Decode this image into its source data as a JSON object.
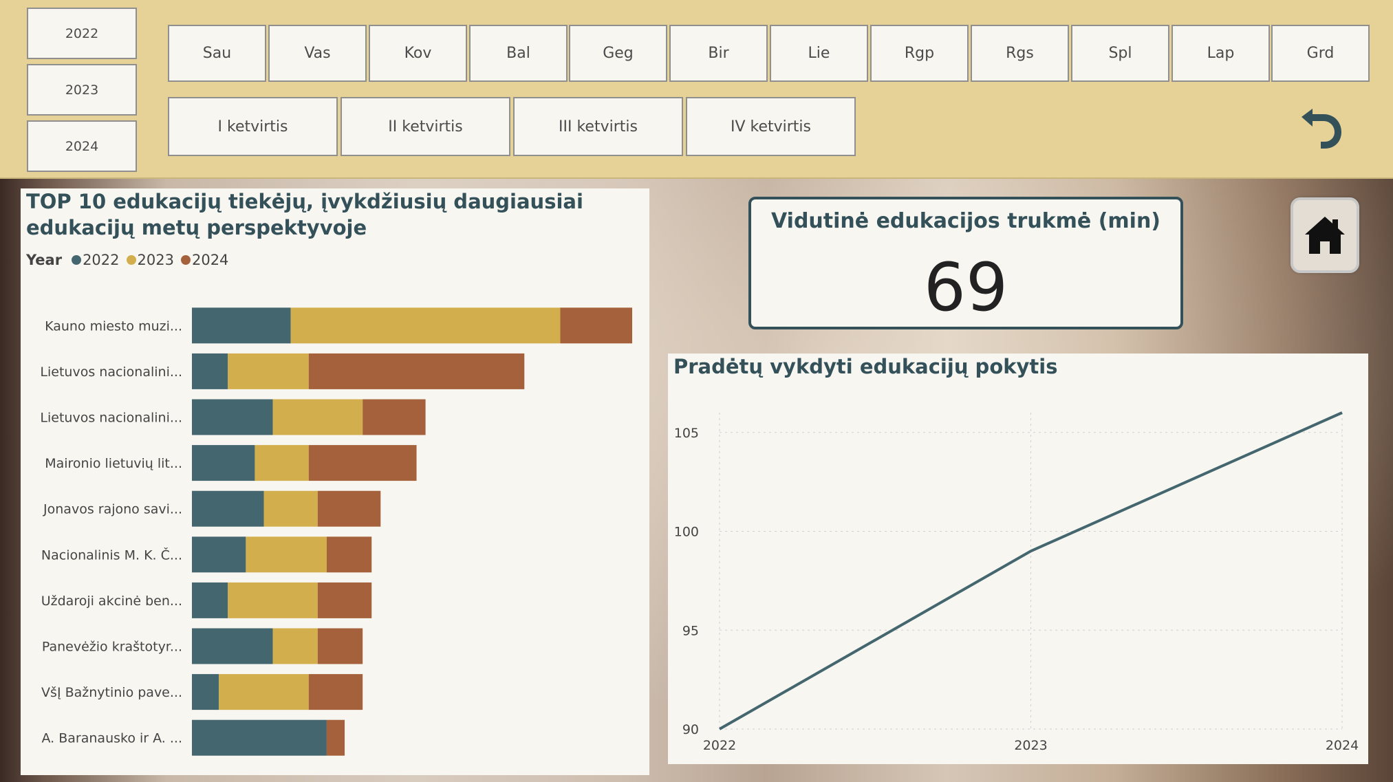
{
  "filters": {
    "years": [
      "2022",
      "2023",
      "2024"
    ],
    "months": [
      "Sau",
      "Vas",
      "Kov",
      "Bal",
      "Geg",
      "Bir",
      "Lie",
      "Rgp",
      "Rgs",
      "Spl",
      "Lap",
      "Grd"
    ],
    "quarters": [
      "I ketvirtis",
      "II ketvirtis",
      "III ketvirtis",
      "IV ketvirtis"
    ]
  },
  "icons": {
    "undo": "undo-arrow-icon",
    "home": "home-icon"
  },
  "colors": {
    "y2022": "#44666f",
    "y2023": "#d2ae4c",
    "y2024": "#a5613b",
    "line": "#44666f",
    "title": "#34515a"
  },
  "kpi": {
    "title": "Vidutinė edukacijos trukmė (min)",
    "value": "69"
  },
  "bar_panel": {
    "title_line1": "TOP 10 edukacijų tiekėjų, įvykdžiusių daugiausiai",
    "title_line2": "edukacijų metų perspektyvoje",
    "legend_title": "Year"
  },
  "line_panel": {
    "title": "Pradėtų vykdyti edukacijų pokytis"
  },
  "chart_data": [
    {
      "type": "bar",
      "orientation": "horizontal",
      "stacked": true,
      "title": "TOP 10 edukacijų tiekėjų, įvykdžiusių daugiausiai edukacijų metų perspektyvoje",
      "legend_title": "Year",
      "legend_position": "top-left",
      "categories": [
        "Kauno miesto muzi...",
        "Lietuvos nacionalini...",
        "Lietuvos nacionalini...",
        "Maironio lietuvių lit...",
        "Jonavos rajono savi...",
        "Nacionalinis M. K. Č...",
        "Uždaroji akcinė ben...",
        "Panevėžio kraštotyr...",
        "VšĮ Bažnytinio pave...",
        "A. Baranausko ir A. ..."
      ],
      "series": [
        {
          "name": "2022",
          "values": [
            11,
            4,
            9,
            7,
            8,
            6,
            4,
            9,
            3,
            15
          ]
        },
        {
          "name": "2023",
          "values": [
            30,
            9,
            10,
            6,
            6,
            9,
            10,
            5,
            10,
            0
          ]
        },
        {
          "name": "2024",
          "values": [
            8,
            24,
            7,
            12,
            7,
            5,
            6,
            5,
            6,
            2
          ]
        }
      ],
      "xlim": [
        0,
        49
      ]
    },
    {
      "type": "line",
      "title": "Pradėtų vykdyti edukacijų pokytis",
      "x": [
        "2022",
        "2023",
        "2024"
      ],
      "series": [
        {
          "values": [
            90,
            99,
            106
          ]
        }
      ],
      "ylim": [
        90,
        106
      ],
      "yticks": [
        90,
        95,
        100,
        105
      ],
      "grid": true
    }
  ]
}
